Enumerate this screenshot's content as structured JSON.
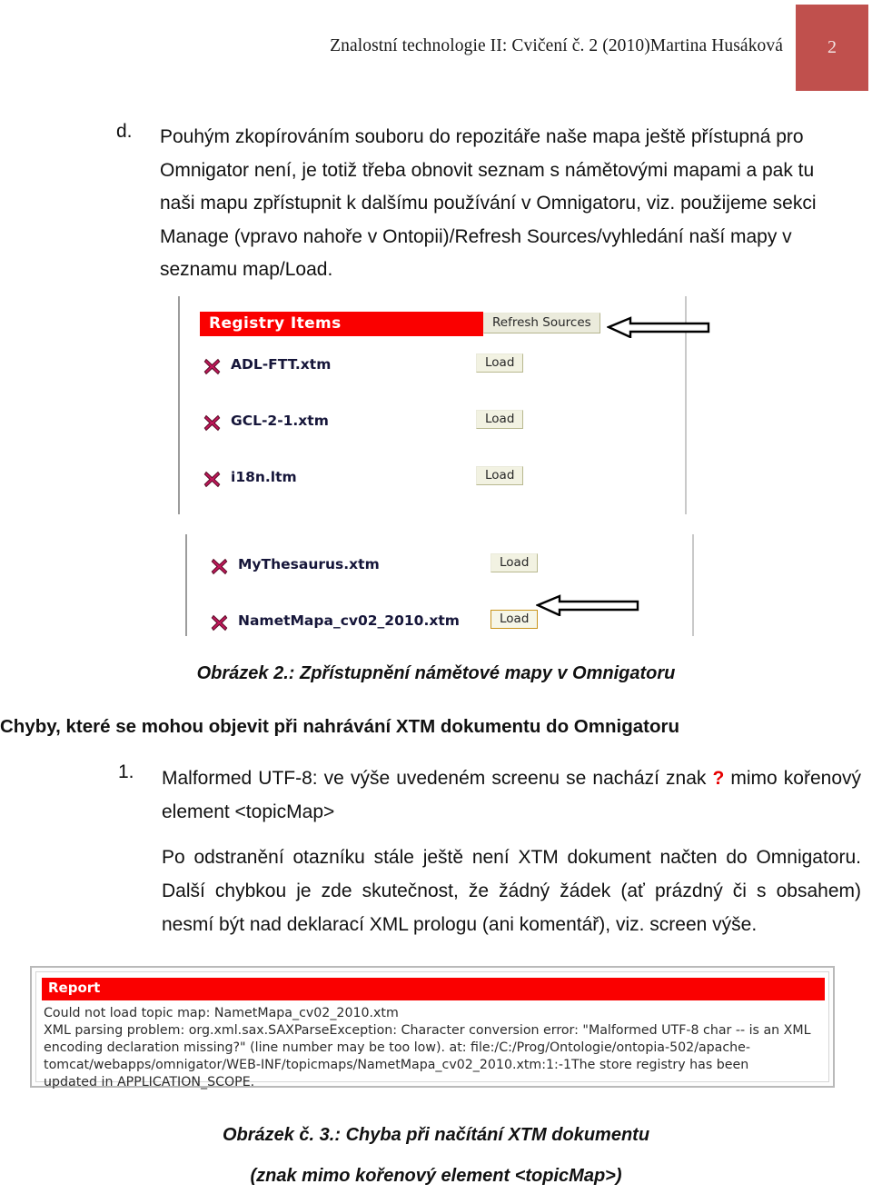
{
  "header": {
    "title": "Znalostní technologie II: Cvičení č. 2 (2010)Martina Husáková",
    "page_number": "2",
    "accent_color": "#c0504d"
  },
  "body": {
    "item_d_marker": "d.",
    "item_d_text": "Pouhým zkopírováním souboru do repozitáře naše mapa ještě přístupná pro Omnigator není, je totiž třeba obnovit seznam s námětovými mapami a pak tu naši mapu zpřístupnit k dalšímu používání v Omnigatoru, viz. použijeme sekci Manage (vpravo nahoře v Ontopii)/Refresh Sources/vyhledání naší mapy v seznamu map/Load.",
    "caption_figure2": "Obrázek 2.: Zpřístupnění námětové mapy v Omnigatoru",
    "errors_heading": "Chyby, které se mohou objevit při nahrávání XTM dokumentu do Omnigatoru",
    "item_1_marker": "1.",
    "item_1_text_before": "Malformed UTF-8: ve výše uvedeném screenu se nachází znak ",
    "item_1_question_mark": "?",
    "item_1_text_after": " mimo kořenový element <topicMap>",
    "paragraph_2": "Po odstranění otazníku stále ještě není XTM dokument načten do Omnigatoru. Další chybkou je zde skutečnost, že žádný žádek (ať prázdný či s obsahem) nesmí být nad deklarací XML prologu (ani komentář), viz. screen výše.",
    "caption_figure3_line1": "Obrázek č. 3.: Chyba při načítání XTM dokumentu",
    "caption_figure3_line2": "(znak mimo kořenový element <topicMap>)"
  },
  "screenshot_registry": {
    "panel_title": "Registry Items",
    "panel_title_bg": "#fa0000",
    "refresh_button": "Refresh Sources",
    "load_button_label": "Load",
    "items": [
      {
        "name": "ADL-FTT.xtm",
        "icon": "delete-x-icon",
        "action": "Load",
        "highlighted": false
      },
      {
        "name": "GCL-2-1.xtm",
        "icon": "delete-x-icon",
        "action": "Load",
        "highlighted": false
      },
      {
        "name": "i18n.ltm",
        "icon": "delete-x-icon",
        "action": "Load",
        "highlighted": false
      },
      {
        "name": "MyThesaurus.xtm",
        "icon": "delete-x-icon",
        "action": "Load",
        "highlighted": false
      },
      {
        "name": "NametMapa_cv02_2010.xtm",
        "icon": "delete-x-icon",
        "action": "Load",
        "highlighted": true
      }
    ],
    "annotation_arrows": 2
  },
  "screenshot_report": {
    "panel_title": "Report",
    "panel_title_bg": "#fa0000",
    "lines": [
      "Could not load topic map: NametMapa_cv02_2010.xtm",
      "XML parsing problem: org.xml.sax.SAXParseException: Character conversion error: \"Malformed UTF-8 char -- is an XML",
      "encoding declaration missing?\" (line number may be too low). at: file:/C:/Prog/Ontologie/ontopia-502/apache-",
      "tomcat/webapps/omnigator/WEB-INF/topicmaps/NametMapa_cv02_2010.xtm:1:-1The store registry has been",
      "updated in APPLICATION_SCOPE."
    ]
  }
}
